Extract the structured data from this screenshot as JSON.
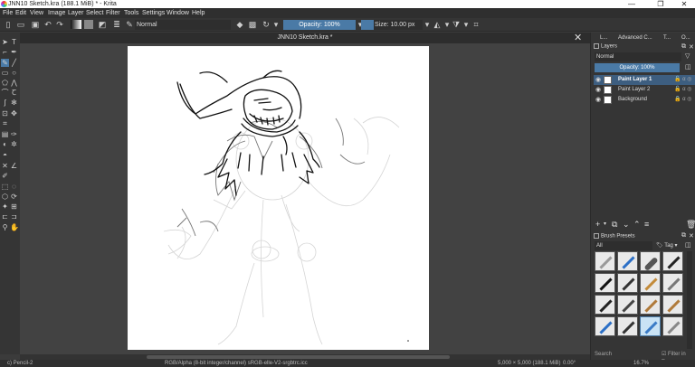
{
  "window": {
    "title": "JNN10 Sketch.kra (188.1 MiB)  * - Krita",
    "minimize": "—",
    "maximize": "❐",
    "close": "✕"
  },
  "menu": [
    "File",
    "Edit",
    "View",
    "Image",
    "Layer",
    "Select",
    "Filter",
    "Tools",
    "Settings",
    "Window",
    "Help"
  ],
  "toolbar": {
    "blend_mode": "Normal",
    "opacity_label": "Opacity: 100%",
    "size_label": "Size: 10.00 px"
  },
  "document": {
    "tab_title": "JNN10 Sketch.kra *"
  },
  "dock": {
    "tabs": [
      "L...",
      "Advanced C...",
      "T...",
      "O..."
    ],
    "layers_title": "Layers",
    "blend_mode": "Normal",
    "opacity_label": "Opacity:  100%",
    "layers": [
      {
        "name": "Paint Layer 1",
        "active": true
      },
      {
        "name": "Paint Layer 2",
        "active": false
      },
      {
        "name": "Background",
        "active": false
      }
    ],
    "brush_presets_title": "Brush Presets",
    "brush_filter": "All",
    "tag_label": "Tag",
    "search_placeholder": "Search",
    "filter_in_tag": "Filter in Tag"
  },
  "status": {
    "brush": "c) Pencil-2",
    "color_space": "RGB/Alpha (8-bit integer/channel)  sRGB-elle-V2-srgbtrc.icc",
    "dimensions": "5,000 × 5,000 (188.1 MiB)",
    "rotation": "0.00°",
    "zoom": "16.7%"
  },
  "colors": {
    "accent": "#4a7aa6",
    "panel": "#353535",
    "canvas_bg": "#424242"
  }
}
